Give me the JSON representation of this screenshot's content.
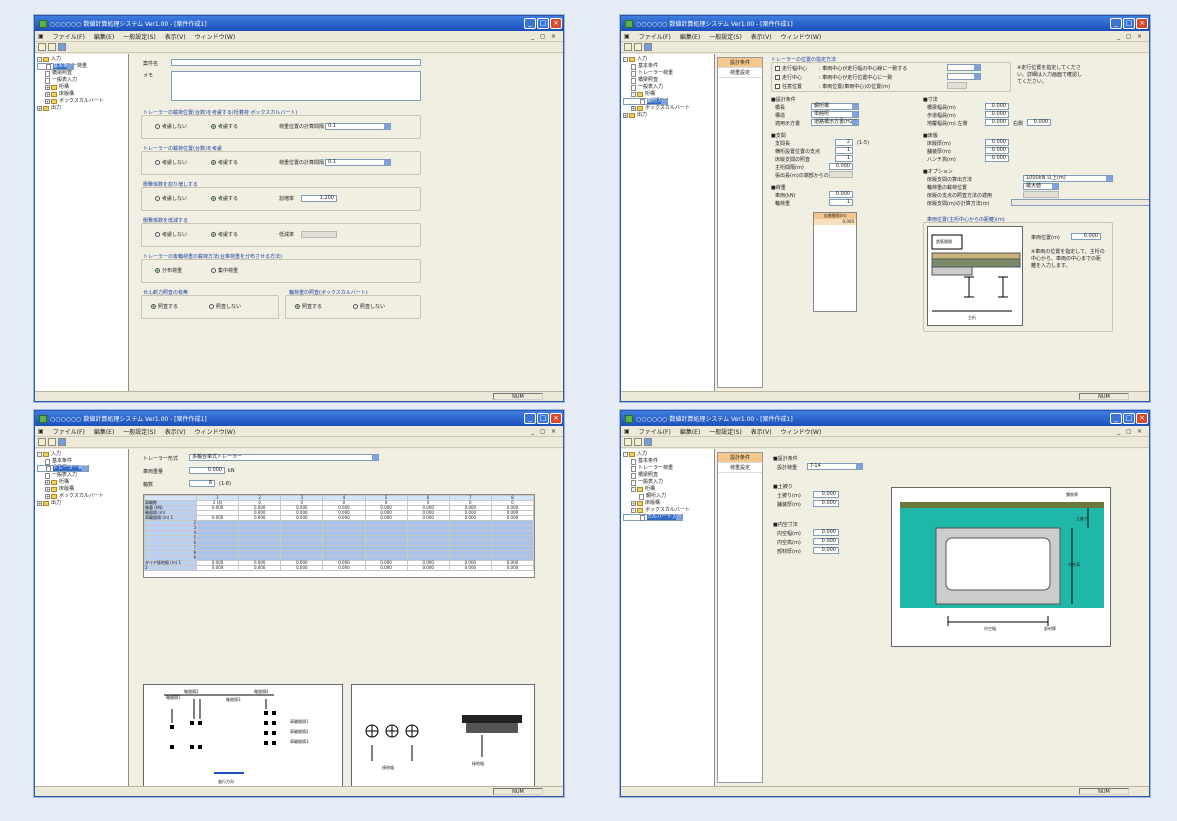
{
  "windows": [
    {
      "id": "w1",
      "title": "○○○○○○ 数値計算処理システム Ver1.00 - [案件作成1]",
      "status": "NUM",
      "tree": [
        {
          "label": "入力",
          "level": 0,
          "type": "folder",
          "exp": "-"
        },
        {
          "label": "基本条件",
          "level": 1,
          "type": "page",
          "sel": true
        },
        {
          "label": "トレーラー荷重",
          "level": 1,
          "type": "page"
        },
        {
          "label": "橋梁照査",
          "level": 1,
          "type": "page"
        },
        {
          "label": "一般表入力",
          "level": 1,
          "type": "page"
        },
        {
          "label": "桁構",
          "level": 1,
          "type": "folder",
          "exp": "+"
        },
        {
          "label": "床版構",
          "level": 1,
          "type": "folder",
          "exp": "+"
        },
        {
          "label": "ボックスカルバート",
          "level": 1,
          "type": "folder",
          "exp": "+"
        },
        {
          "label": "出力",
          "level": 0,
          "type": "folder",
          "exp": "+"
        }
      ],
      "form": {
        "case_label": "案件名",
        "memo_label": "メモ",
        "g1_title": "トレーラーの載荷位置(台数)を考慮する(桁着荷 ボックスカルバート)",
        "g1_r1": "考慮しない",
        "g1_r2": "考慮する",
        "g1_sel_label": "荷重位置の計算間隔",
        "g1_sel": "0.1",
        "g2_title": "トレーラーの載荷位置(台数)を考慮",
        "g2_r1": "考慮しない",
        "g2_r2": "考慮する",
        "g2_sel_label": "荷重位置の計算間隔",
        "g2_sel": "0.1",
        "g3_title": "衝撃係数を割り増しする",
        "g3_r1": "考慮しない",
        "g3_r2": "考慮する",
        "g3_in_label": "割増率",
        "g3_in": "1.200",
        "g4_title": "衝撃係数を低減する",
        "g4_r1": "考慮しない",
        "g4_r2": "考慮する",
        "g4_in_label": "低減率",
        "g5_title": "トレーラーの後輪荷重の載荷方法(台車荷重を分布させる方法)",
        "g5_r1": "分布荷重",
        "g5_r2": "集中荷重",
        "g6_title": "せん断力照査の有無",
        "g6_r1": "照査する",
        "g6_r2": "照査しない",
        "g7_title": "輪荷重の照査(ボックスカルバート)",
        "g7_r1": "照査する",
        "g7_r2": "照査しない"
      }
    },
    {
      "id": "w2",
      "title": "○○○○○○ 数値計算処理システム Ver1.00 - [案件作成1]",
      "status": "NUM",
      "tabs": [
        "設計条件",
        "荷重設定"
      ],
      "tree": [
        {
          "label": "入力",
          "level": 0,
          "type": "folder",
          "exp": "-"
        },
        {
          "label": "基本条件",
          "level": 1,
          "type": "page"
        },
        {
          "label": "トレーラー荷重",
          "level": 1,
          "type": "page"
        },
        {
          "label": "橋梁照査",
          "level": 1,
          "type": "page"
        },
        {
          "label": "一般表入力",
          "level": 1,
          "type": "page"
        },
        {
          "label": "桁構",
          "level": 1,
          "type": "folder",
          "exp": "-"
        },
        {
          "label": "鋼桁入力",
          "level": 2,
          "type": "page",
          "sel": true
        },
        {
          "label": "床版構",
          "level": 1,
          "type": "folder",
          "exp": "+"
        },
        {
          "label": "ボックスカルバート",
          "level": 1,
          "type": "folder",
          "exp": "+"
        },
        {
          "label": "出力",
          "level": 0,
          "type": "folder",
          "exp": "+"
        }
      ],
      "form": {
        "top_title": "トレーラーの位置の指定方法",
        "c1": "走行幅中心",
        "c1d": ": 車両中心が走行幅の中心線に一致する",
        "c2": "走行中心",
        "c2d": ": 車両中心が走行位置中心に一致",
        "c3": "任意位置",
        "c3d": ": 車両位置(車両中心)の位置(m)",
        "note": "※走行位置を指定してください。詳細は入力画面で確認してください。",
        "s1": "■設計条件",
        "s1_rows": [
          {
            "label": "橋長",
            "value": "鋼桁橋"
          },
          {
            "label": "構造",
            "value": "単純桁"
          },
          {
            "label": "適用示方書",
            "value": "道路橋示方書(H24)"
          }
        ],
        "s2": "■支間",
        "s2_rows": [
          {
            "label": "支間長",
            "value": "2",
            "unit": "(1-5)"
          },
          {
            "label": "横桁設置位置の支点",
            "value": "1"
          },
          {
            "label": "床版支間の照査",
            "value": "1"
          },
          {
            "label": "主桁間隔(m)",
            "value": "0.000"
          },
          {
            "label": "張出長(m)の端部からの距離",
            "value": ""
          }
        ],
        "s3": "■荷重",
        "s3_rows": [
          {
            "label": "車両(kN)",
            "value": "0.000"
          },
          {
            "label": "輪荷重",
            "value": "1"
          }
        ],
        "mini_head": "支間間隔(m)",
        "mini_val": "0.000",
        "r1": "■寸法",
        "r1_rows": [
          {
            "label": "橋梁幅員(m)",
            "value": "0.000"
          },
          {
            "label": "歩道幅員(m)",
            "value": "0.000"
          },
          {
            "label": "地覆幅員(m) 左側",
            "value": "0.000",
            "label2": "右側",
            "value2": "0.000"
          }
        ],
        "r2": "■床版",
        "r2_rows": [
          {
            "label": "床版厚(m)",
            "value": "0.000"
          },
          {
            "label": "舗装厚(m)",
            "value": "0.000"
          },
          {
            "label": "ハンチ高(m)",
            "value": "0.000"
          }
        ],
        "r3": "■オプション",
        "r3_rows": [
          {
            "label": "床版支間の算出方法",
            "value": "1000kN 以上(m)"
          },
          {
            "label": "輪荷重の載荷位置",
            "value": "最大値"
          },
          {
            "label": "床版の支点の照査方法の適用",
            "value": ""
          },
          {
            "label": "床版支間(m)の計算方法(m)",
            "value": ""
          }
        ],
        "diag_title": "車両位置(主桁中心からの距離)(m)",
        "diag_box": "鉄筋間隔",
        "diag_bottom": "主桁",
        "diag_note_label": "車両位置(m)",
        "diag_note_val": "0.000",
        "diag_note": "※車両の位置を指定して、主桁の中心から、車両の中心までの距離を入力します。"
      }
    },
    {
      "id": "w3",
      "title": "○○○○○○ 数値計算処理システム Ver1.00 - [案件作成1]",
      "status": "NUM",
      "tree": [
        {
          "label": "入力",
          "level": 0,
          "type": "folder",
          "exp": "-"
        },
        {
          "label": "基本条件",
          "level": 1,
          "type": "page"
        },
        {
          "label": "トレーラー荷重",
          "level": 1,
          "type": "page",
          "sel": true
        },
        {
          "label": "橋梁照査",
          "level": 1,
          "type": "page"
        },
        {
          "label": "一般表入力",
          "level": 1,
          "type": "page"
        },
        {
          "label": "桁構",
          "level": 1,
          "type": "folder",
          "exp": "+"
        },
        {
          "label": "床版構",
          "level": 1,
          "type": "folder",
          "exp": "+"
        },
        {
          "label": "ボックスカルバート",
          "level": 1,
          "type": "folder",
          "exp": "+"
        },
        {
          "label": "出力",
          "level": 0,
          "type": "folder",
          "exp": "+"
        }
      ],
      "form": {
        "type_label": "トレーラー形式",
        "type_value": "多軸台車式トレーラー",
        "weight_label": "車両重量",
        "weight_value": "0.000",
        "weight_unit": "kN",
        "axle_label": "軸数",
        "axle_value": "8",
        "axle_unit": "(1-8)",
        "cols": [
          "1",
          "2",
          "3",
          "4",
          "5",
          "6",
          "7",
          "8"
        ],
        "rows": [
          {
            "label": "車輪数",
            "vals": [
              "2 (4)",
              "0",
              "0",
              "0",
              "0",
              "0",
              "0",
              "0"
            ]
          },
          {
            "label": "軸重 (kN)",
            "vals": [
              "0.000",
              "0.000",
              "0.000",
              "0.000",
              "0.000",
              "0.000",
              "0.000",
              "0.000"
            ]
          },
          {
            "label": "軸間隔 (m)",
            "vals": [
              "",
              "0.000",
              "0.000",
              "0.000",
              "0.000",
              "0.000",
              "0.000",
              "0.000"
            ]
          },
          {
            "label": "車輪間隔 (m) 1",
            "vals": [
              "0.000",
              "0.000",
              "0.000",
              "0.000",
              "0.000",
              "0.000",
              "0.000",
              "0.000"
            ]
          },
          {
            "label": "2",
            "vals": [
              "",
              "",
              "",
              "",
              "",
              "",
              "",
              ""
            ]
          },
          {
            "label": "3",
            "vals": [
              "",
              "",
              "",
              "",
              "",
              "",
              "",
              ""
            ]
          },
          {
            "label": "4",
            "vals": [
              "",
              "",
              "",
              "",
              "",
              "",
              "",
              ""
            ]
          },
          {
            "label": "5",
            "vals": [
              "",
              "",
              "",
              "",
              "",
              "",
              "",
              ""
            ]
          },
          {
            "label": "6",
            "vals": [
              "",
              "",
              "",
              "",
              "",
              "",
              "",
              ""
            ]
          },
          {
            "label": "7",
            "vals": [
              "",
              "",
              "",
              "",
              "",
              "",
              "",
              ""
            ]
          },
          {
            "label": "8",
            "vals": [
              "",
              "",
              "",
              "",
              "",
              "",
              "",
              ""
            ]
          },
          {
            "label": "9",
            "vals": [
              "",
              "",
              "",
              "",
              "",
              "",
              "",
              ""
            ]
          },
          {
            "label": "タイヤ接地幅 (m) 1",
            "vals": [
              "0.000",
              "0.000",
              "0.000",
              "0.000",
              "0.000",
              "0.000",
              "0.000",
              "0.000"
            ]
          },
          {
            "label": "2",
            "vals": [
              "0.000",
              "0.000",
              "0.000",
              "0.000",
              "0.000",
              "0.000",
              "0.000",
              "0.000"
            ]
          }
        ],
        "d1_labels": [
          "軸間隔1",
          "軸間隔2",
          "軸間隔3",
          "軸間隔4",
          "車輪間隔1",
          "車輪間隔2",
          "車輪間隔3"
        ],
        "d1_dir": "進行方向",
        "d2_labels": [
          "接地幅",
          "接地幅"
        ]
      }
    },
    {
      "id": "w4",
      "title": "○○○○○○ 数値計算処理システム Ver1.00 - [案件作成1]",
      "status": "NUM",
      "tabs": [
        "設計条件",
        "荷重設定"
      ],
      "tree": [
        {
          "label": "入力",
          "level": 0,
          "type": "folder",
          "exp": "-"
        },
        {
          "label": "基本条件",
          "level": 1,
          "type": "page"
        },
        {
          "label": "トレーラー荷重",
          "level": 1,
          "type": "page"
        },
        {
          "label": "橋梁照査",
          "level": 1,
          "type": "page"
        },
        {
          "label": "一般表入力",
          "level": 1,
          "type": "page"
        },
        {
          "label": "桁構",
          "level": 1,
          "type": "folder",
          "exp": "-"
        },
        {
          "label": "鋼桁入力",
          "level": 2,
          "type": "page"
        },
        {
          "label": "床版構",
          "level": 1,
          "type": "folder",
          "exp": "+"
        },
        {
          "label": "ボックスカルバート",
          "level": 1,
          "type": "folder",
          "exp": "-"
        },
        {
          "label": "カルバート入力",
          "level": 2,
          "type": "page",
          "sel": true
        },
        {
          "label": "出力",
          "level": 0,
          "type": "folder",
          "exp": "+"
        }
      ],
      "form": {
        "s1": "■設計条件",
        "s1_label": "設計荷重",
        "s1_value": "T-14",
        "s2": "■土被り",
        "s2_rows": [
          {
            "label": "土被り(m)",
            "value": "0.000"
          },
          {
            "label": "舗装厚(m)",
            "value": "0.000"
          }
        ],
        "s3": "■内空寸法",
        "s3_rows": [
          {
            "label": "内空幅(m)",
            "value": "0.000"
          },
          {
            "label": "内空高(m)",
            "value": "0.000"
          },
          {
            "label": "部材厚(m)",
            "value": "0.000"
          }
        ],
        "d_labels": [
          "舗装厚",
          "土被り",
          "内空高",
          "内空幅",
          "部材厚"
        ]
      }
    }
  ],
  "menu": [
    "ファイル(F)",
    "編集(E)",
    "一般設定(S)",
    "表示(V)",
    "ウィンドウ(W)"
  ],
  "mdi_controls": "_ ◻ ×"
}
